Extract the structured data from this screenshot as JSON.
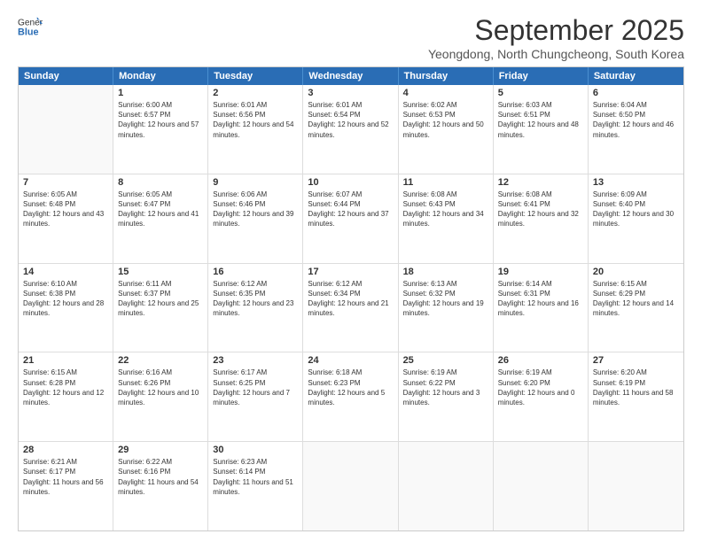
{
  "header": {
    "logo_general": "General",
    "logo_blue": "Blue",
    "month_title": "September 2025",
    "location": "Yeongdong, North Chungcheong, South Korea"
  },
  "weekdays": [
    "Sunday",
    "Monday",
    "Tuesday",
    "Wednesday",
    "Thursday",
    "Friday",
    "Saturday"
  ],
  "weeks": [
    [
      {
        "day": "",
        "sunrise": "",
        "sunset": "",
        "daylight": ""
      },
      {
        "day": "1",
        "sunrise": "Sunrise: 6:00 AM",
        "sunset": "Sunset: 6:57 PM",
        "daylight": "Daylight: 12 hours and 57 minutes."
      },
      {
        "day": "2",
        "sunrise": "Sunrise: 6:01 AM",
        "sunset": "Sunset: 6:56 PM",
        "daylight": "Daylight: 12 hours and 54 minutes."
      },
      {
        "day": "3",
        "sunrise": "Sunrise: 6:01 AM",
        "sunset": "Sunset: 6:54 PM",
        "daylight": "Daylight: 12 hours and 52 minutes."
      },
      {
        "day": "4",
        "sunrise": "Sunrise: 6:02 AM",
        "sunset": "Sunset: 6:53 PM",
        "daylight": "Daylight: 12 hours and 50 minutes."
      },
      {
        "day": "5",
        "sunrise": "Sunrise: 6:03 AM",
        "sunset": "Sunset: 6:51 PM",
        "daylight": "Daylight: 12 hours and 48 minutes."
      },
      {
        "day": "6",
        "sunrise": "Sunrise: 6:04 AM",
        "sunset": "Sunset: 6:50 PM",
        "daylight": "Daylight: 12 hours and 46 minutes."
      }
    ],
    [
      {
        "day": "7",
        "sunrise": "Sunrise: 6:05 AM",
        "sunset": "Sunset: 6:48 PM",
        "daylight": "Daylight: 12 hours and 43 minutes."
      },
      {
        "day": "8",
        "sunrise": "Sunrise: 6:05 AM",
        "sunset": "Sunset: 6:47 PM",
        "daylight": "Daylight: 12 hours and 41 minutes."
      },
      {
        "day": "9",
        "sunrise": "Sunrise: 6:06 AM",
        "sunset": "Sunset: 6:46 PM",
        "daylight": "Daylight: 12 hours and 39 minutes."
      },
      {
        "day": "10",
        "sunrise": "Sunrise: 6:07 AM",
        "sunset": "Sunset: 6:44 PM",
        "daylight": "Daylight: 12 hours and 37 minutes."
      },
      {
        "day": "11",
        "sunrise": "Sunrise: 6:08 AM",
        "sunset": "Sunset: 6:43 PM",
        "daylight": "Daylight: 12 hours and 34 minutes."
      },
      {
        "day": "12",
        "sunrise": "Sunrise: 6:08 AM",
        "sunset": "Sunset: 6:41 PM",
        "daylight": "Daylight: 12 hours and 32 minutes."
      },
      {
        "day": "13",
        "sunrise": "Sunrise: 6:09 AM",
        "sunset": "Sunset: 6:40 PM",
        "daylight": "Daylight: 12 hours and 30 minutes."
      }
    ],
    [
      {
        "day": "14",
        "sunrise": "Sunrise: 6:10 AM",
        "sunset": "Sunset: 6:38 PM",
        "daylight": "Daylight: 12 hours and 28 minutes."
      },
      {
        "day": "15",
        "sunrise": "Sunrise: 6:11 AM",
        "sunset": "Sunset: 6:37 PM",
        "daylight": "Daylight: 12 hours and 25 minutes."
      },
      {
        "day": "16",
        "sunrise": "Sunrise: 6:12 AM",
        "sunset": "Sunset: 6:35 PM",
        "daylight": "Daylight: 12 hours and 23 minutes."
      },
      {
        "day": "17",
        "sunrise": "Sunrise: 6:12 AM",
        "sunset": "Sunset: 6:34 PM",
        "daylight": "Daylight: 12 hours and 21 minutes."
      },
      {
        "day": "18",
        "sunrise": "Sunrise: 6:13 AM",
        "sunset": "Sunset: 6:32 PM",
        "daylight": "Daylight: 12 hours and 19 minutes."
      },
      {
        "day": "19",
        "sunrise": "Sunrise: 6:14 AM",
        "sunset": "Sunset: 6:31 PM",
        "daylight": "Daylight: 12 hours and 16 minutes."
      },
      {
        "day": "20",
        "sunrise": "Sunrise: 6:15 AM",
        "sunset": "Sunset: 6:29 PM",
        "daylight": "Daylight: 12 hours and 14 minutes."
      }
    ],
    [
      {
        "day": "21",
        "sunrise": "Sunrise: 6:15 AM",
        "sunset": "Sunset: 6:28 PM",
        "daylight": "Daylight: 12 hours and 12 minutes."
      },
      {
        "day": "22",
        "sunrise": "Sunrise: 6:16 AM",
        "sunset": "Sunset: 6:26 PM",
        "daylight": "Daylight: 12 hours and 10 minutes."
      },
      {
        "day": "23",
        "sunrise": "Sunrise: 6:17 AM",
        "sunset": "Sunset: 6:25 PM",
        "daylight": "Daylight: 12 hours and 7 minutes."
      },
      {
        "day": "24",
        "sunrise": "Sunrise: 6:18 AM",
        "sunset": "Sunset: 6:23 PM",
        "daylight": "Daylight: 12 hours and 5 minutes."
      },
      {
        "day": "25",
        "sunrise": "Sunrise: 6:19 AM",
        "sunset": "Sunset: 6:22 PM",
        "daylight": "Daylight: 12 hours and 3 minutes."
      },
      {
        "day": "26",
        "sunrise": "Sunrise: 6:19 AM",
        "sunset": "Sunset: 6:20 PM",
        "daylight": "Daylight: 12 hours and 0 minutes."
      },
      {
        "day": "27",
        "sunrise": "Sunrise: 6:20 AM",
        "sunset": "Sunset: 6:19 PM",
        "daylight": "Daylight: 11 hours and 58 minutes."
      }
    ],
    [
      {
        "day": "28",
        "sunrise": "Sunrise: 6:21 AM",
        "sunset": "Sunset: 6:17 PM",
        "daylight": "Daylight: 11 hours and 56 minutes."
      },
      {
        "day": "29",
        "sunrise": "Sunrise: 6:22 AM",
        "sunset": "Sunset: 6:16 PM",
        "daylight": "Daylight: 11 hours and 54 minutes."
      },
      {
        "day": "30",
        "sunrise": "Sunrise: 6:23 AM",
        "sunset": "Sunset: 6:14 PM",
        "daylight": "Daylight: 11 hours and 51 minutes."
      },
      {
        "day": "",
        "sunrise": "",
        "sunset": "",
        "daylight": ""
      },
      {
        "day": "",
        "sunrise": "",
        "sunset": "",
        "daylight": ""
      },
      {
        "day": "",
        "sunrise": "",
        "sunset": "",
        "daylight": ""
      },
      {
        "day": "",
        "sunrise": "",
        "sunset": "",
        "daylight": ""
      }
    ]
  ]
}
